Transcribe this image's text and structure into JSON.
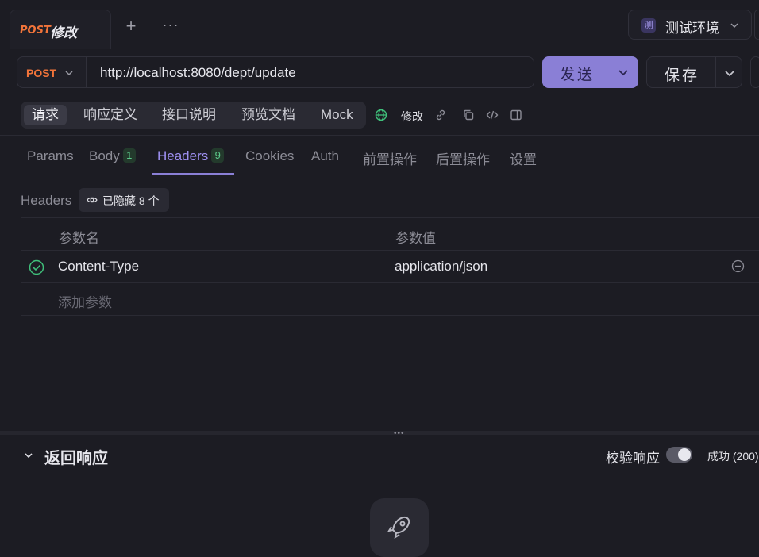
{
  "request_tab": {
    "method": "POST",
    "name": "修改"
  },
  "tab_actions": {
    "add": "+",
    "more": "···"
  },
  "environment": {
    "badge": "测",
    "label": "测试环境"
  },
  "url_bar": {
    "method": "POST",
    "url": "http://localhost:8080/dept/update",
    "send_label": "发送",
    "save_label": "保存"
  },
  "mode_tabs": {
    "items": [
      "请求",
      "响应定义",
      "接口说明",
      "预览文档",
      "Mock"
    ],
    "active": "请求",
    "endpoint_label": "修改"
  },
  "sub_tabs": {
    "params": "Params",
    "body": "Body",
    "body_count": "1",
    "headers": "Headers",
    "headers_count": "9",
    "cookies": "Cookies",
    "auth": "Auth",
    "pre": "前置操作",
    "post": "后置操作",
    "settings": "设置"
  },
  "headers_section": {
    "title": "Headers",
    "hidden_label": "已隐藏 8 个",
    "col_name": "参数名",
    "col_value": "参数值",
    "rows": [
      {
        "name": "Content-Type",
        "value": "application/json",
        "enabled": true
      }
    ],
    "add_placeholder": "添加参数"
  },
  "response": {
    "title": "返回响应",
    "verify_label": "校验响应",
    "verify_enabled": true,
    "status": "成功 (200)"
  },
  "colors": {
    "accent": "#8a7fd6",
    "method_post": "#f2743a",
    "success": "#5cc88a"
  }
}
